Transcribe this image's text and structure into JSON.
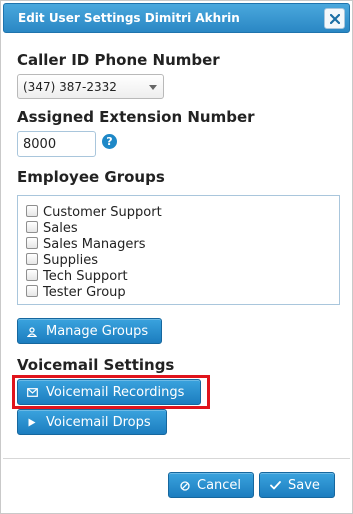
{
  "dialog": {
    "title": "Edit User Settings Dimitri Akhrin"
  },
  "caller_id": {
    "label": "Caller ID Phone Number",
    "selected_value": "(347) 387-2332"
  },
  "extension": {
    "label": "Assigned Extension Number",
    "value": "8000",
    "help_icon": "?"
  },
  "employee_groups": {
    "label": "Employee Groups",
    "items": [
      {
        "label": "Customer Support",
        "checked": false
      },
      {
        "label": "Sales",
        "checked": false
      },
      {
        "label": "Sales Managers",
        "checked": false
      },
      {
        "label": "Supplies",
        "checked": false
      },
      {
        "label": "Tech Support",
        "checked": false
      },
      {
        "label": "Tester Group",
        "checked": false
      }
    ],
    "manage_button": {
      "label": "Manage Groups",
      "icon": "user-icon"
    }
  },
  "voicemail": {
    "label": "Voicemail Settings",
    "recordings_button": {
      "label": "Voicemail Recordings",
      "icon": "envelope-icon"
    },
    "drops_button": {
      "label": "Voicemail Drops",
      "icon": "play-icon"
    }
  },
  "footer": {
    "cancel_button": {
      "label": "Cancel",
      "icon": "cancel-circle-icon"
    },
    "save_button": {
      "label": "Save",
      "icon": "check-icon"
    }
  },
  "colors": {
    "accent": "#2a87c4",
    "button": "#1c7dbf",
    "highlight": "#e0141c"
  }
}
